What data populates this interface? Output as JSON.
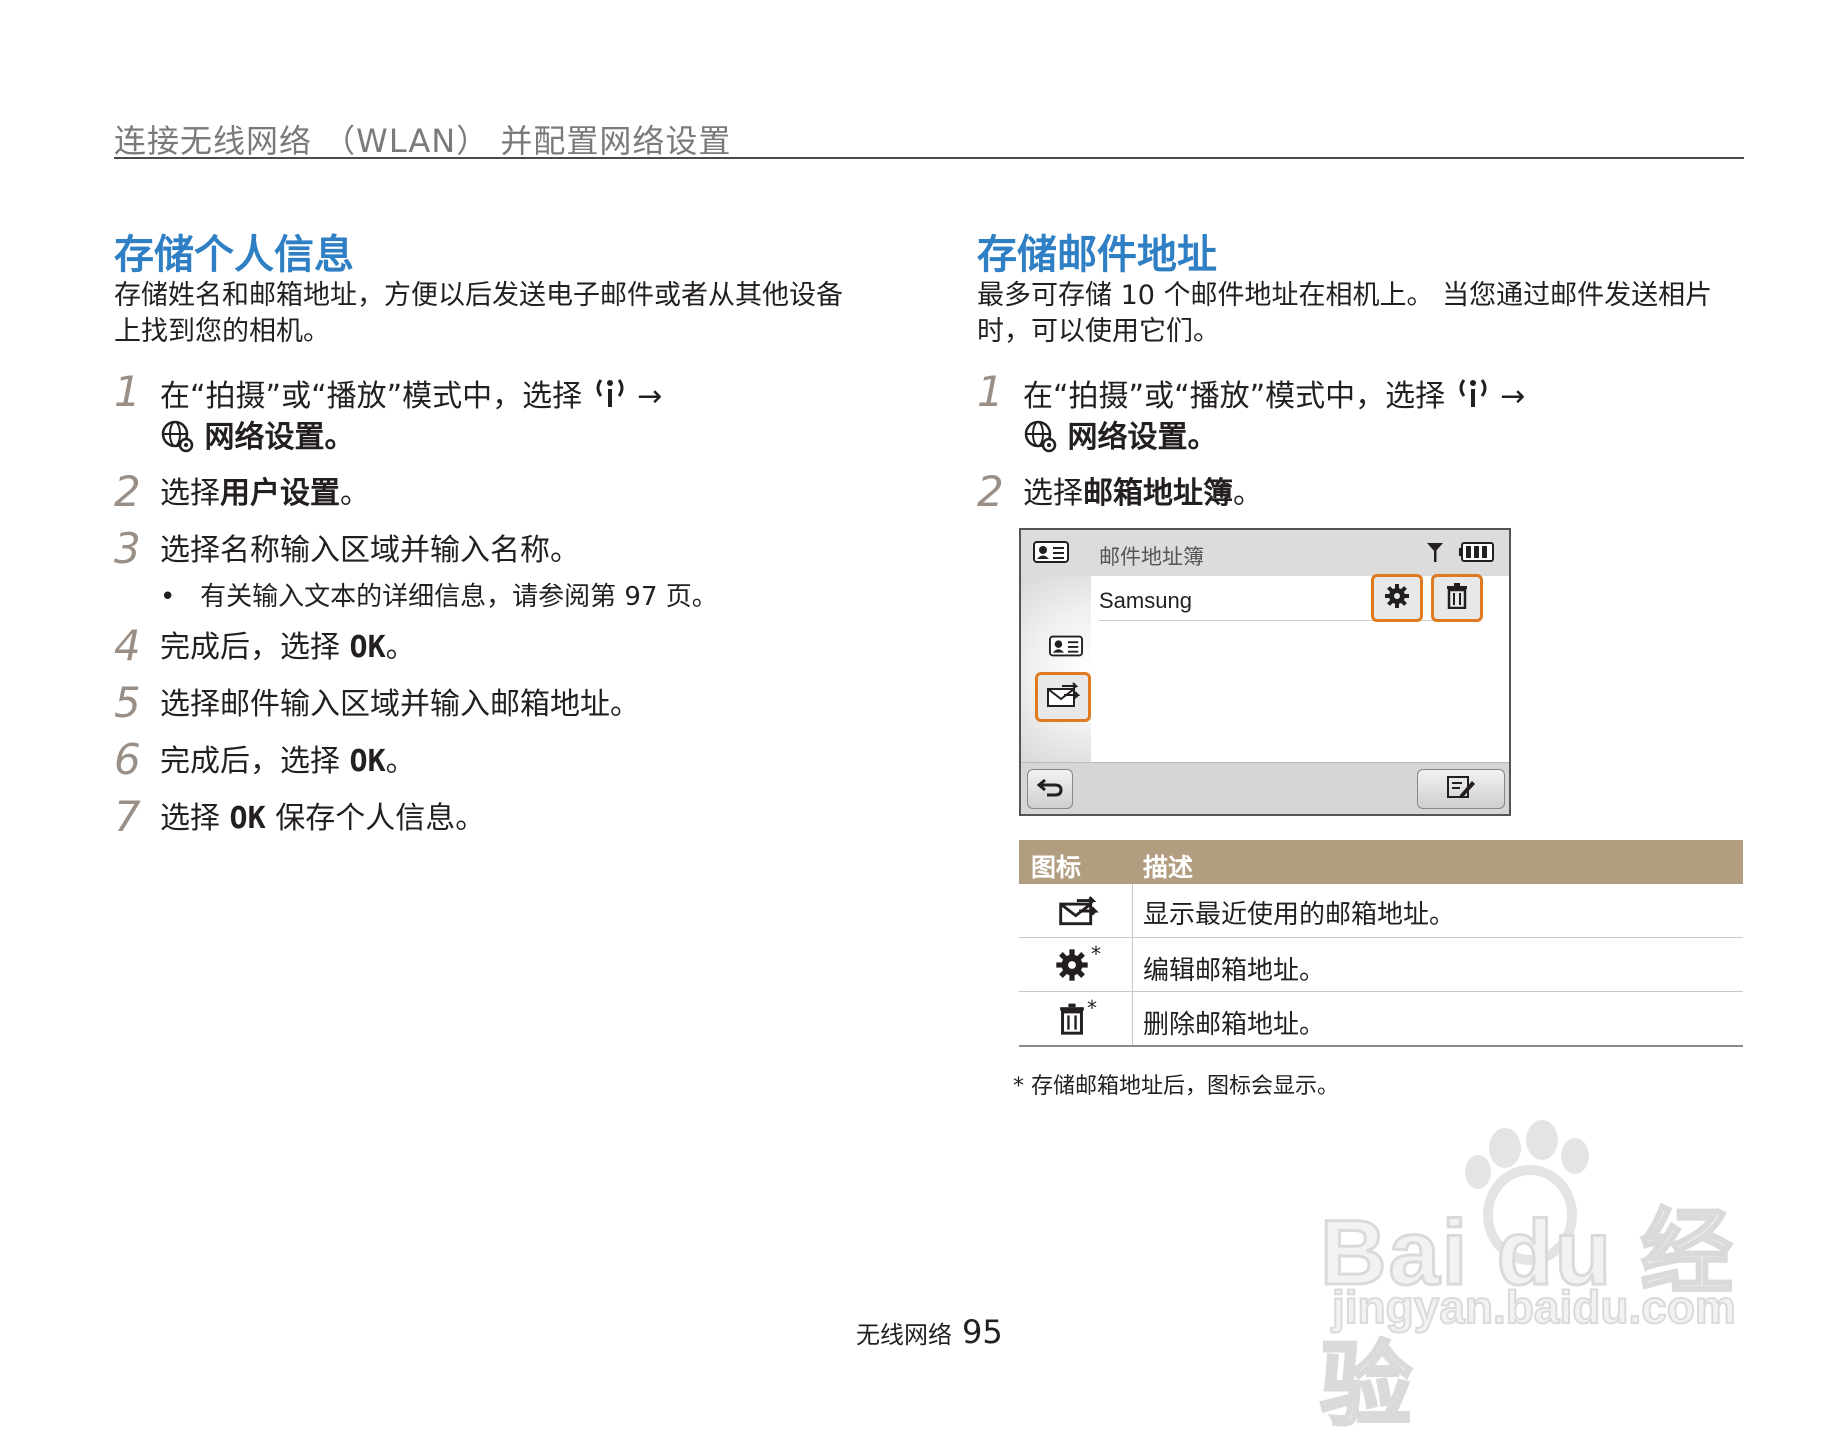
{
  "header": {
    "title": "连接无线网络 （WLAN） 并配置网络设置"
  },
  "left": {
    "title": "存储个人信息",
    "intro_line1": "存储姓名和邮箱地址，方便以后发送电子邮件或者从其他设备",
    "intro_line2": "上找到您的相机。",
    "steps": [
      {
        "num": "1",
        "line1": "在“拍摄”或“播放”模式中，选择",
        "arrow": "→",
        "line2": "网络设置。"
      },
      {
        "num": "2",
        "pre": "选择",
        "bold": "用户设置",
        "post": "。"
      },
      {
        "num": "3",
        "text": "选择名称输入区域并输入名称。",
        "bullet": "有关输入文本的详细信息，请参阅第 97 页。"
      },
      {
        "num": "4",
        "pre": "完成后，选择 ",
        "ok": "OK",
        "post": "。"
      },
      {
        "num": "5",
        "text": "选择邮件输入区域并输入邮箱地址。"
      },
      {
        "num": "6",
        "pre": "完成后，选择 ",
        "ok": "OK",
        "post": "。"
      },
      {
        "num": "7",
        "pre": "选择 ",
        "ok": "OK",
        "post": " 保存个人信息。"
      }
    ]
  },
  "right": {
    "title": "存储邮件地址",
    "intro_line1": "最多可存储 10 个邮件地址在相机上。 当您通过邮件发送相片",
    "intro_line2": "时，可以使用它们。",
    "steps": [
      {
        "num": "1",
        "line1": "在“拍摄”或“播放”模式中，选择",
        "arrow": "→",
        "line2": "网络设置。"
      },
      {
        "num": "2",
        "pre": "选择",
        "bold": "邮箱地址簿",
        "post": "。"
      }
    ],
    "screen": {
      "title": "邮件地址簿",
      "entry": "Samsung"
    },
    "table": {
      "headers": [
        "图标",
        "描述"
      ],
      "rows": [
        {
          "icon": "envelope-arrows-icon",
          "desc": "显示最近使用的邮箱地址。"
        },
        {
          "icon": "gear-icon",
          "star": "*",
          "desc": "编辑邮箱地址。"
        },
        {
          "icon": "trash-icon",
          "star": "*",
          "desc": "删除邮箱地址。"
        }
      ]
    },
    "footnote": "* 存储邮箱地址后，图标会显示。"
  },
  "footer": {
    "section": "无线网络",
    "page": "95"
  },
  "watermark": {
    "logo": "Bai du 经验",
    "url": "jingyan.baidu.com"
  },
  "colors": {
    "accent": "#2f7fc4",
    "highlight": "#e07a20",
    "table_header": "#b29d80",
    "step_number": "#9a8f86"
  }
}
